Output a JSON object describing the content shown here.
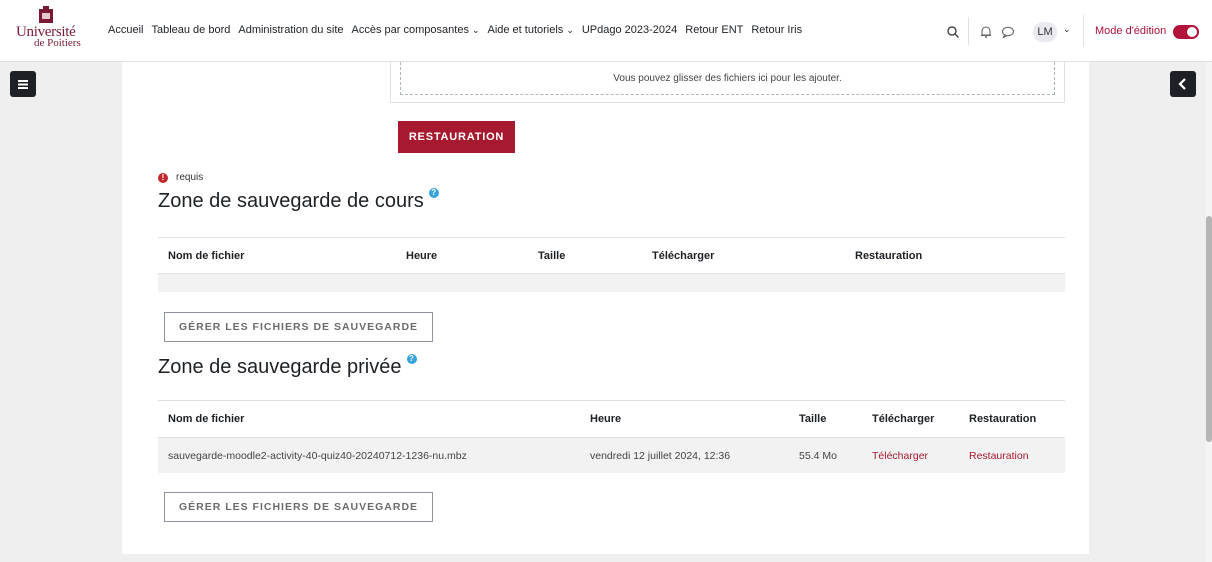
{
  "brand": {
    "line1": "Université",
    "line2": "de Poitiers"
  },
  "nav": {
    "items": [
      {
        "label": "Accueil",
        "dropdown": false
      },
      {
        "label": "Tableau de bord",
        "dropdown": false
      },
      {
        "label": "Administration du site",
        "dropdown": false
      },
      {
        "label": "Accès par composantes",
        "dropdown": true
      },
      {
        "label": "Aide et tutoriels",
        "dropdown": true
      },
      {
        "label": "UPdago 2023-2024",
        "dropdown": false
      },
      {
        "label": "Retour ENT",
        "dropdown": false
      },
      {
        "label": "Retour Iris",
        "dropdown": false
      }
    ],
    "user_initials": "LM",
    "edit_mode_label": "Mode d'édition",
    "edit_mode_on": true
  },
  "colors": {
    "accent": "#a6192e",
    "link": "#a6192e",
    "help": "#36a4d8"
  },
  "upload": {
    "dropzone_text": "Vous pouvez glisser des fichiers ici pour les ajouter.",
    "restore_button": "RESTAURATION",
    "required_label": "requis"
  },
  "course_backup": {
    "title": "Zone de sauvegarde de cours",
    "headers": [
      "Nom de fichier",
      "Heure",
      "Taille",
      "Télécharger",
      "Restauration"
    ],
    "rows": [],
    "manage_button": "GÉRER LES FICHIERS DE SAUVEGARDE"
  },
  "private_backup": {
    "title": "Zone de sauvegarde privée",
    "headers": [
      "Nom de fichier",
      "Heure",
      "Taille",
      "Télécharger",
      "Restauration"
    ],
    "rows": [
      {
        "filename": "sauvegarde-moodle2-activity-40-quiz40-20240712-1236-nu.mbz",
        "time": "vendredi 12 juillet 2024, 12:36",
        "size": "55.4 Mo",
        "download": "Télécharger",
        "restore": "Restauration"
      }
    ],
    "manage_button": "GÉRER LES FICHIERS DE SAUVEGARDE"
  }
}
